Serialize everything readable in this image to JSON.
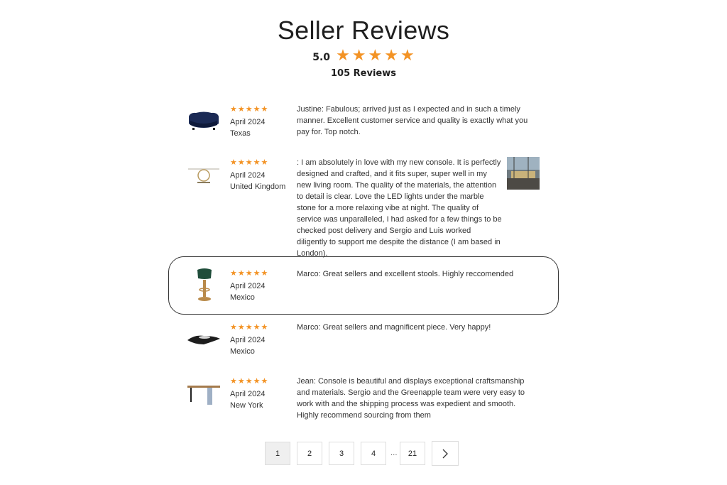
{
  "header": {
    "title": "Seller Reviews",
    "rating_value": "5.0",
    "rating_stars": 5,
    "review_count": "105 Reviews"
  },
  "colors": {
    "star": "#f39325",
    "border": "#333333"
  },
  "reviews": [
    {
      "product_icon": "sofa-icon",
      "stars": 5,
      "date": "April 2024",
      "location": "Texas",
      "text": "Justine: Fabulous; arrived just as I expected and in such a timely manner. Excellent customer service and quality is exactly what you pay for. Top notch."
    },
    {
      "product_icon": "console-table-icon",
      "stars": 5,
      "date": "April 2024",
      "location": "United Kingdom",
      "text": ": I am absolutely in love with my new console. It is perfectly designed and crafted, and it fits super, super well in my new living room. The quality of the materials, the attention to detail is clear. Love the LED lights under the marble stone for a more relaxing vibe at night. The quality of service was unparalleled, I had asked for a few things to be checked post delivery and Sergio and Luis worked diligently to support me despite the distance (I am based in London).",
      "photo": "customer-photo"
    },
    {
      "product_icon": "bar-stool-icon",
      "stars": 5,
      "date": "April 2024",
      "location": "Mexico",
      "text": "Marco: Great sellers and excellent stools. Highly reccomended",
      "highlighted": true
    },
    {
      "product_icon": "sculpture-icon",
      "stars": 5,
      "date": "April 2024",
      "location": "Mexico",
      "text": "Marco: Great sellers and magnificent piece. Very happy!"
    },
    {
      "product_icon": "desk-console-icon",
      "stars": 5,
      "date": "April 2024",
      "location": "New York",
      "text": "Jean: Console is beautiful and displays exceptional craftsmanship and materials. Sergio and the Greenapple team were very easy to work with and the shipping process was expedient and smooth. Highly recommend sourcing from them"
    }
  ],
  "pagination": {
    "pages": [
      "1",
      "2",
      "3",
      "4"
    ],
    "ellipsis": "...",
    "last": "21",
    "current": "1",
    "next_icon": "chevron-right-icon"
  }
}
